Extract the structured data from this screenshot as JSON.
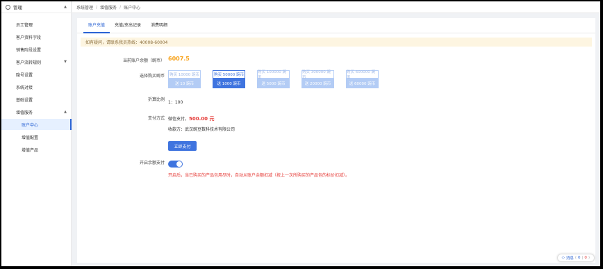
{
  "sidebar": {
    "header": {
      "label": "管理",
      "icon": "user-icon"
    },
    "items": [
      {
        "label": "员工管理"
      },
      {
        "label": "客户资料字段"
      },
      {
        "label": "销售阶段设置"
      },
      {
        "label": "客户流转规则"
      },
      {
        "label": "隐号设置"
      },
      {
        "label": "系统对接"
      },
      {
        "label": "基础设置"
      },
      {
        "label": "增值服务"
      },
      {
        "label": "账户中心"
      },
      {
        "label": "增值配置"
      },
      {
        "label": "增值产品"
      }
    ],
    "active": "账户中心"
  },
  "breadcrumb": [
    "系统管理",
    "增值服务",
    "账户中心"
  ],
  "tabs": [
    {
      "label": "账户充值",
      "active": true
    },
    {
      "label": "充值/支出记录",
      "active": false
    },
    {
      "label": "消费明细",
      "active": false
    }
  ],
  "notice": "如有疑问，请联系我员热线：40008-60004",
  "balance": {
    "label": "当前账户余额（豌币）",
    "value": "6007.5"
  },
  "packages": {
    "label": "选择购买豌币",
    "items": [
      {
        "buy": "购买 10000 豌币",
        "bonus": "送 10 豌币",
        "selected": false
      },
      {
        "buy": "购买 50000 豌币",
        "bonus": "送 1000 豌币",
        "selected": true
      },
      {
        "buy": "购买 100000 豌币",
        "bonus": "送 5000 豌币",
        "selected": false
      },
      {
        "buy": "购买 300000 豌币",
        "bonus": "送 20000 豌币",
        "selected": false
      },
      {
        "buy": "购买 600000 豌币",
        "bonus": "送 60000 豌币",
        "selected": false
      }
    ]
  },
  "ratio": {
    "label": "折算比例",
    "value": "1：100"
  },
  "payment": {
    "label": "支付方式",
    "method": "微信支付，",
    "amount": "500.00 元",
    "payee": "收款方：武汉豌豆数科技术有限公司",
    "button": "立即支付"
  },
  "auto_pay": {
    "label": "开启余额支付",
    "enabled": true,
    "hint": "开启后，当已购买的产品包用尽时，自动从账户余额扣减（按上一次所购买的产品包的标价扣减）。"
  },
  "messages": {
    "label": "消息",
    "count_a": "0",
    "count_b": "0"
  },
  "colors": {
    "primary": "#3f74df",
    "balance": "#f7a21a",
    "warning": "#e53935"
  }
}
